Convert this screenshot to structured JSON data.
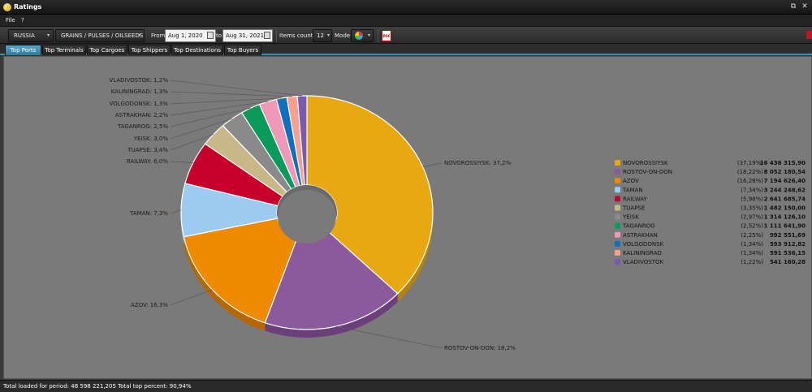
{
  "window": {
    "title": "Ratings",
    "restore_glyph": "⧉",
    "close_glyph": "✕"
  },
  "menu": {
    "file": "File",
    "help": "?"
  },
  "toolbar": {
    "country": "RUSSIA",
    "cargo_group": "GRAINS / PULSES / OILSEEDS",
    "from_label": "From",
    "from_date": "Aug 1, 2020",
    "to_label": "to",
    "to_date": "Aug 31, 2021",
    "items_count_label": "Items count:",
    "items_count": "12",
    "mode_label": "Mode:",
    "dropdown_arrow": "▾",
    "export_text": "PDF"
  },
  "tabs": [
    {
      "label": "Top Ports",
      "active": true
    },
    {
      "label": "Top Terminals",
      "active": false
    },
    {
      "label": "Top Cargoes",
      "active": false
    },
    {
      "label": "Top Shippers",
      "active": false
    },
    {
      "label": "Top Destinations",
      "active": false
    },
    {
      "label": "Top Buyers",
      "active": false
    }
  ],
  "status": {
    "text": "Total loaded for period: 48 598 221,205  Total top percent: 90,94%"
  },
  "chart_data": {
    "type": "pie",
    "variant": "donut-3d",
    "start_angle_deg": 0,
    "slices": [
      {
        "name": "NOVOROSSIYSK",
        "label": "NOVOROSSIYSK: 37,2%",
        "percent": 37.19,
        "legend_percent": "(37,19%)",
        "value": "16 436 315,90",
        "color": "#e8a812",
        "side": "#b88208"
      },
      {
        "name": "ROSTOV-ON-DON",
        "label": "ROSTOV-ON-DON: 18,2%",
        "percent": 18.22,
        "legend_percent": "(18,22%)",
        "value": "8 052 180,54",
        "color": "#8a5a9c",
        "side": "#6a3f7c"
      },
      {
        "name": "AZOV",
        "label": "AZOV: 16,3%",
        "percent": 16.28,
        "legend_percent": "(16,28%)",
        "value": "7 194 626,40",
        "color": "#f08a00",
        "side": "#b86600"
      },
      {
        "name": "TAMAN",
        "label": "TAMAN: 7,3%",
        "percent": 7.34,
        "legend_percent": "(7,34%)",
        "value": "3 244 248,62",
        "color": "#9dcaf0",
        "side": "#7aa4c8"
      },
      {
        "name": "RAILWAY",
        "label": "RAILWAY: 6,0%",
        "percent": 5.98,
        "legend_percent": "(5,98%)",
        "value": "2 641 685,74",
        "color": "#c8002c",
        "side": "#98001f"
      },
      {
        "name": "TUAPSE",
        "label": "TUAPSE: 3,4%",
        "percent": 3.35,
        "legend_percent": "(3,35%)",
        "value": "1 482 150,00",
        "color": "#c8b888",
        "side": "#a09068"
      },
      {
        "name": "YEISK",
        "label": "YEISK: 3,0%",
        "percent": 2.97,
        "legend_percent": "(2,97%)",
        "value": "1 314 126,10",
        "color": "#8a8a8a",
        "side": "#666666"
      },
      {
        "name": "TAGANROG",
        "label": "TAGANROG: 2,5%",
        "percent": 2.52,
        "legend_percent": "(2,52%)",
        "value": "1 111 641,90",
        "color": "#0a9a5a",
        "side": "#087040"
      },
      {
        "name": "ASTRAKHAN",
        "label": "ASTRAKHAN: 2,2%",
        "percent": 2.25,
        "legend_percent": "(2,25%)",
        "value": "992 551,69",
        "color": "#f098b8",
        "side": "#c87090"
      },
      {
        "name": "VOLGODONSK",
        "label": "VOLGODONSK: 1,3%",
        "percent": 1.34,
        "legend_percent": "(1,34%)",
        "value": "593 912,82",
        "color": "#1070c0",
        "side": "#0a5090"
      },
      {
        "name": "KALININGRAD",
        "label": "KALININGRAD: 1,3%",
        "percent": 1.34,
        "legend_percent": "(1,34%)",
        "value": "591 536,15",
        "color": "#f8a090",
        "side": "#c87868"
      },
      {
        "name": "VLADIVOSTOK",
        "label": "VLADIVOSTOK: 1,2%",
        "percent": 1.22,
        "legend_percent": "(1,22%)",
        "value": "541 160,28",
        "color": "#7a5ab0",
        "side": "#5a3e88"
      }
    ]
  }
}
